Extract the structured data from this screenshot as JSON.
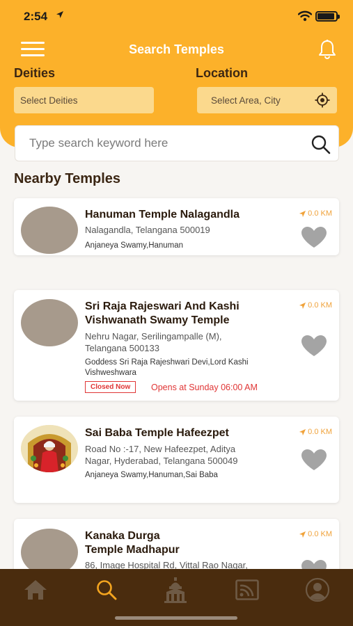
{
  "status_bar": {
    "time": "2:54"
  },
  "header": {
    "title": "Search Temples"
  },
  "filters": {
    "deities_label": "Deities",
    "deities_placeholder": "Select Deities",
    "location_label": "Location",
    "location_placeholder": "Select Area, City"
  },
  "search": {
    "placeholder": "Type search keyword here"
  },
  "section": {
    "title": "Nearby Temples"
  },
  "temples": [
    {
      "name": "Hanuman Temple Nalagandla",
      "address": "Nalagandla, Telangana 500019",
      "deities": "Anjaneya Swamy,Hanuman",
      "distance": "0.0 KM"
    },
    {
      "name_line1": "Sri Raja Rajeswari And Kashi",
      "name_line2": "Vishwanath Swamy Temple",
      "address_line1": "Nehru Nagar, Serilingampalle (M),",
      "address_line2": "Telangana 500133",
      "deities_line1": "Goddess Sri Raja Rajeshwari Devi,Lord Kashi",
      "deities_line2": "Vishweshwara",
      "status": "Closed Now",
      "opens": "Opens at Sunday 06:00 AM",
      "distance": "0.0 KM"
    },
    {
      "name": "Sai Baba Temple Hafeezpet",
      "address_line1": "Road No :-17, New Hafeezpet, Aditya",
      "address_line2": "Nagar, Hyderabad, Telangana 500049",
      "deities": "Anjaneya Swamy,Hanuman,Sai Baba",
      "distance": "0.0 KM"
    },
    {
      "name_line1": "Kanaka Durga",
      "name_line2": "Temple Madhapur",
      "address_line1": "86, Image Hospital Rd, Vittal Rao Nagar,",
      "distance": "0.0 KM"
    }
  ],
  "tabs": [
    {
      "icon": "home-icon",
      "active": false
    },
    {
      "icon": "search-icon",
      "active": true
    },
    {
      "icon": "temple-icon",
      "active": false
    },
    {
      "icon": "cast-icon",
      "active": false
    },
    {
      "icon": "profile-icon",
      "active": false
    }
  ],
  "colors": {
    "brand": "#fcb12a",
    "tabbar": "#4a2c0e",
    "closed": "#e03535",
    "distance": "#f0a23a"
  }
}
